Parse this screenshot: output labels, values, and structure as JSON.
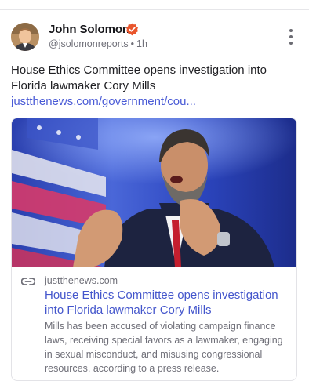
{
  "post": {
    "author_name": "John Solomon",
    "handle": "@jsolomonreports",
    "separator": "•",
    "time": "1h",
    "text": "House Ethics Committee opens investigation into Florida lawmaker Cory Mills ",
    "link_text": "justthenews.com/government/cou...",
    "colors": {
      "link": "#4a5bd6",
      "verified": "#e9552c"
    }
  },
  "link_card": {
    "domain": "justthenews.com",
    "title": "House Ethics Committee opens investigation into Florida lawmaker Cory Mills",
    "description": "Mills has been accused of violating campaign finance laws, receiving special favors as a lawmaker, engaging in sexual misconduct, and misusing congressional resources, according to a press release."
  }
}
